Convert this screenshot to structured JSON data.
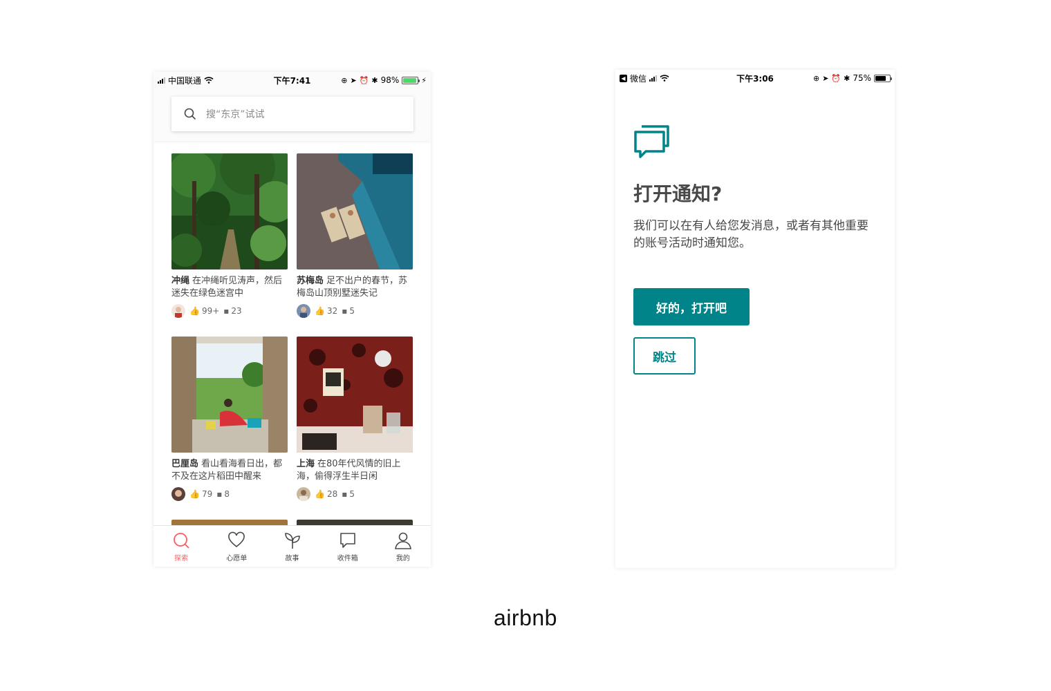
{
  "brand": "airbnb",
  "colors": {
    "accent": "#008489",
    "brand_red": "#ff5a5f",
    "battery_green": "#4cd964"
  },
  "phone1": {
    "status": {
      "carrier": "中国联通",
      "time": "下午7:41",
      "battery": "98%"
    },
    "search": {
      "placeholder": "搜“东京”试试"
    },
    "cards": [
      {
        "place": "冲绳",
        "text": "在冲绳听见涛声，然后迷失在绿色迷宫中",
        "likes": "99+",
        "comments": "23"
      },
      {
        "place": "苏梅岛",
        "text": "足不出户的春节，苏梅岛山顶别墅迷失记",
        "likes": "32",
        "comments": "5"
      },
      {
        "place": "巴厘岛",
        "text": "看山看海看日出，都不及在这片稻田中醒来",
        "likes": "79",
        "comments": "8"
      },
      {
        "place": "上海",
        "text": "在80年代风情的旧上海，偷得浮生半日闲",
        "likes": "28",
        "comments": "5"
      }
    ],
    "tabs": [
      {
        "label": "探索",
        "icon": "search-icon",
        "active": true
      },
      {
        "label": "心愿单",
        "icon": "heart-icon"
      },
      {
        "label": "故事",
        "icon": "sprout-icon"
      },
      {
        "label": "收件箱",
        "icon": "message-icon"
      },
      {
        "label": "我的",
        "icon": "user-icon"
      }
    ]
  },
  "phone2": {
    "status": {
      "back_app": "微信",
      "time": "下午3:06",
      "battery": "75%"
    },
    "icon": "chat-bubbles-icon",
    "title": "打开通知?",
    "body": "我们可以在有人给您发消息，或者有其他重要的账号活动时通知您。",
    "primary_button": "好的，打开吧",
    "secondary_button": "跳过"
  }
}
